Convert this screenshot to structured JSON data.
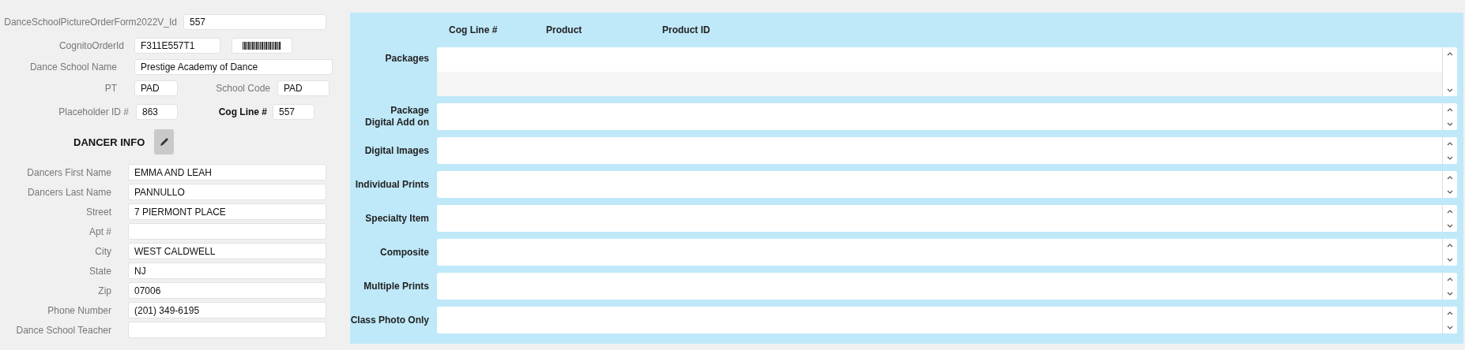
{
  "order": {
    "form_id": {
      "label": "DanceSchoolPictureOrderForm2022V_Id",
      "value": "557"
    },
    "cognito_order_id": {
      "label": "CognitoOrderId",
      "value": "F311E557T1"
    },
    "school_name": {
      "label": "Dance School Name",
      "value": "Prestige Academy of Dance"
    },
    "pt": {
      "label": "PT",
      "value": "PAD"
    },
    "school_code": {
      "label": "School Code",
      "value": "PAD"
    },
    "placeholder_id": {
      "label": "Placeholder ID #",
      "value": "863"
    },
    "cog_line": {
      "label": "Cog Line #",
      "value": "557"
    }
  },
  "dancer_info": {
    "title": "DANCER INFO",
    "fields": [
      {
        "label": "Dancers First Name",
        "value": "EMMA AND LEAH"
      },
      {
        "label": "Dancers Last Name",
        "value": "PANNULLO"
      },
      {
        "label": "Street",
        "value": "7 PIERMONT PLACE"
      },
      {
        "label": "Apt #"
      },
      {
        "label": "City",
        "value": "WEST CALDWELL"
      },
      {
        "label": "State",
        "value": "NJ"
      },
      {
        "label": "Zip",
        "value": "07006"
      },
      {
        "label": "Phone Number",
        "value": "(201) 349-6195"
      },
      {
        "label": "Dance School Teacher"
      }
    ]
  },
  "products": {
    "columns": [
      "Cog Line #",
      "Product",
      "Product ID"
    ],
    "sections": [
      {
        "label": "Packages",
        "kind": "double"
      },
      {
        "label": "Package\nDigital Add on",
        "kind": "single"
      },
      {
        "label": "Digital Images",
        "kind": "single"
      },
      {
        "label": "Individual Prints",
        "kind": "single"
      },
      {
        "label": "Specialty Item",
        "kind": "single"
      },
      {
        "label": "Composite",
        "kind": "single"
      },
      {
        "label": "Multiple Prints",
        "kind": "single"
      },
      {
        "label": "Class Photo Only",
        "kind": "single"
      }
    ]
  }
}
